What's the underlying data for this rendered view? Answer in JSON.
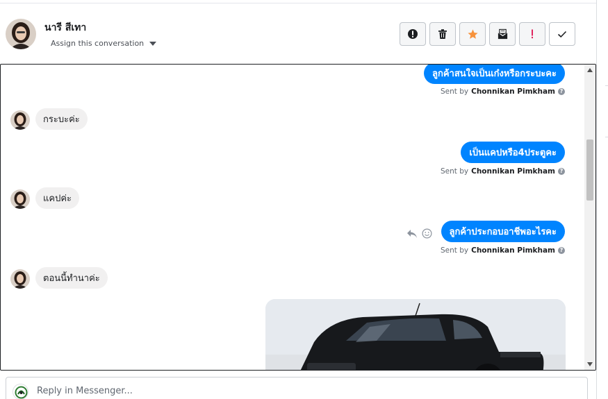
{
  "header": {
    "contact_name": "นารี สีเทา",
    "assign_label": "Assign this conversation",
    "actions": [
      {
        "name": "report-spam",
        "icon": "alert-circle-icon"
      },
      {
        "name": "delete",
        "icon": "trash-icon"
      },
      {
        "name": "star",
        "icon": "star-icon"
      },
      {
        "name": "mark-unread",
        "icon": "envelope-icon"
      },
      {
        "name": "important",
        "icon": "exclamation-icon"
      },
      {
        "name": "done",
        "icon": "check-icon"
      }
    ]
  },
  "messages": [
    {
      "direction": "out",
      "text": "ลูกค้าสนใจเป็นเก๋งหรือกระบะคะ",
      "sent_by_prefix": "Sent by",
      "sender": "Chonnikan Pimkham"
    },
    {
      "direction": "in",
      "text": "กระบะค่ะ"
    },
    {
      "direction": "out",
      "text": "เป็นแคปหรือ4ประตูคะ",
      "sent_by_prefix": "Sent by",
      "sender": "Chonnikan Pimkham"
    },
    {
      "direction": "in",
      "text": "แคปค่ะ"
    },
    {
      "direction": "out",
      "text": "ลูกค้าประกอบอาชีพอะไรคะ",
      "sent_by_prefix": "Sent by",
      "sender": "Chonnikan Pimkham"
    },
    {
      "direction": "in",
      "text": "ตอนนี้ทำนาค่ะ"
    }
  ],
  "reply": {
    "placeholder": "Reply in Messenger..."
  },
  "colors": {
    "outgoing_bubble": "#0084ff",
    "incoming_bubble": "#f1f0f0",
    "star": "#f7923b",
    "important": "#e0245e"
  }
}
